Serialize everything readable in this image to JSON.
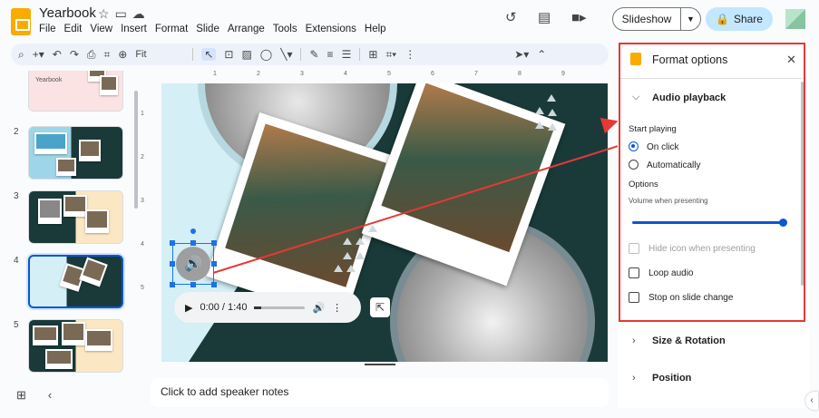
{
  "app": {
    "doc_title": "Yearbook",
    "menu": [
      "File",
      "Edit",
      "View",
      "Insert",
      "Format",
      "Slide",
      "Arrange",
      "Tools",
      "Extensions",
      "Help"
    ],
    "slideshow_label": "Slideshow",
    "share_label": "Share"
  },
  "toolbar": {
    "zoom_label": "Fit"
  },
  "filmstrip": {
    "slides": [
      {
        "number": "",
        "label": "Yearbook"
      },
      {
        "number": "2"
      },
      {
        "number": "3"
      },
      {
        "number": "4",
        "active": true
      },
      {
        "number": "5"
      }
    ]
  },
  "rulers": {
    "h_ticks": [
      "1",
      "2",
      "3",
      "4",
      "5",
      "6",
      "7",
      "8",
      "9"
    ],
    "v_ticks": [
      "1",
      "2",
      "3",
      "4",
      "5"
    ]
  },
  "player": {
    "time": "0:00 / 1:40"
  },
  "notes": {
    "placeholder": "Click to add speaker notes"
  },
  "panel": {
    "title": "Format options",
    "sections": {
      "audio_playback": "Audio playback",
      "size_rotation": "Size & Rotation",
      "position": "Position"
    },
    "start_playing_label": "Start playing",
    "start_options": [
      "On click",
      "Automatically"
    ],
    "selected_start": "On click",
    "options_label": "Options",
    "volume_label": "Volume when presenting",
    "volume_fraction": 1.0,
    "checkboxes": [
      {
        "label": "Hide icon when presenting",
        "checked": false,
        "disabled": true
      },
      {
        "label": "Loop audio",
        "checked": false,
        "disabled": false
      },
      {
        "label": "Stop on slide change",
        "checked": false,
        "disabled": false
      }
    ]
  },
  "colors": {
    "accent": "#0b57d0",
    "share_bg": "#c2e7ff",
    "highlight": "#e53935",
    "slide_dark": "#1a3a3a",
    "slide_light": "#d4eff6"
  }
}
